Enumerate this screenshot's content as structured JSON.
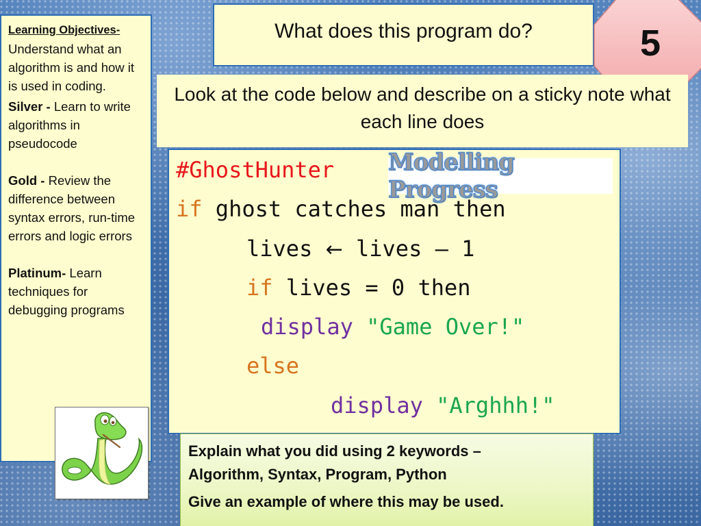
{
  "objectives": {
    "heading": "Learning Objectives-",
    "intro": "Understand what an algorithm is and how it is used in coding.",
    "levels": [
      {
        "label": "Silver -",
        "text": " Learn to write algorithms in pseudocode"
      },
      {
        "label": "Gold -",
        "text": " Review the difference between syntax errors, run-time errors and logic errors"
      },
      {
        "label": "Platinum-",
        "text": " Learn techniques for debugging programs"
      }
    ]
  },
  "title": "What does this program do?",
  "badge": {
    "number": "5",
    "color": "#f6b8b8"
  },
  "instruction": "Look at the code below and describe on a sticky note what each line does",
  "logo_text": "Modelling Progress",
  "code": {
    "comment": "#GhostHunter",
    "line1": {
      "kw": "if",
      "rest": " ghost catches man then"
    },
    "line2": {
      "pre": "lives ",
      "arrow": "←",
      "post": " lives – 1"
    },
    "line3": {
      "kw": "if",
      "rest": " lives = 0 then"
    },
    "line4": {
      "fn": "display",
      "str": " \"Game Over!\""
    },
    "line5": {
      "kw": "else"
    },
    "line6": {
      "fn": "display",
      "str": " \"Arghhh!\""
    }
  },
  "explain": {
    "line1": "Explain what you did using 2 keywords –",
    "line2": "Algorithm, Syntax, Program, Python",
    "line3": "Give an example of where this may be used."
  },
  "colors": {
    "box_fill": "#fefdcf",
    "box_border": "#2d6db5",
    "comment": "#e8161b",
    "keyword": "#d7741e",
    "function": "#7030a0",
    "string": "#1aa64f"
  }
}
